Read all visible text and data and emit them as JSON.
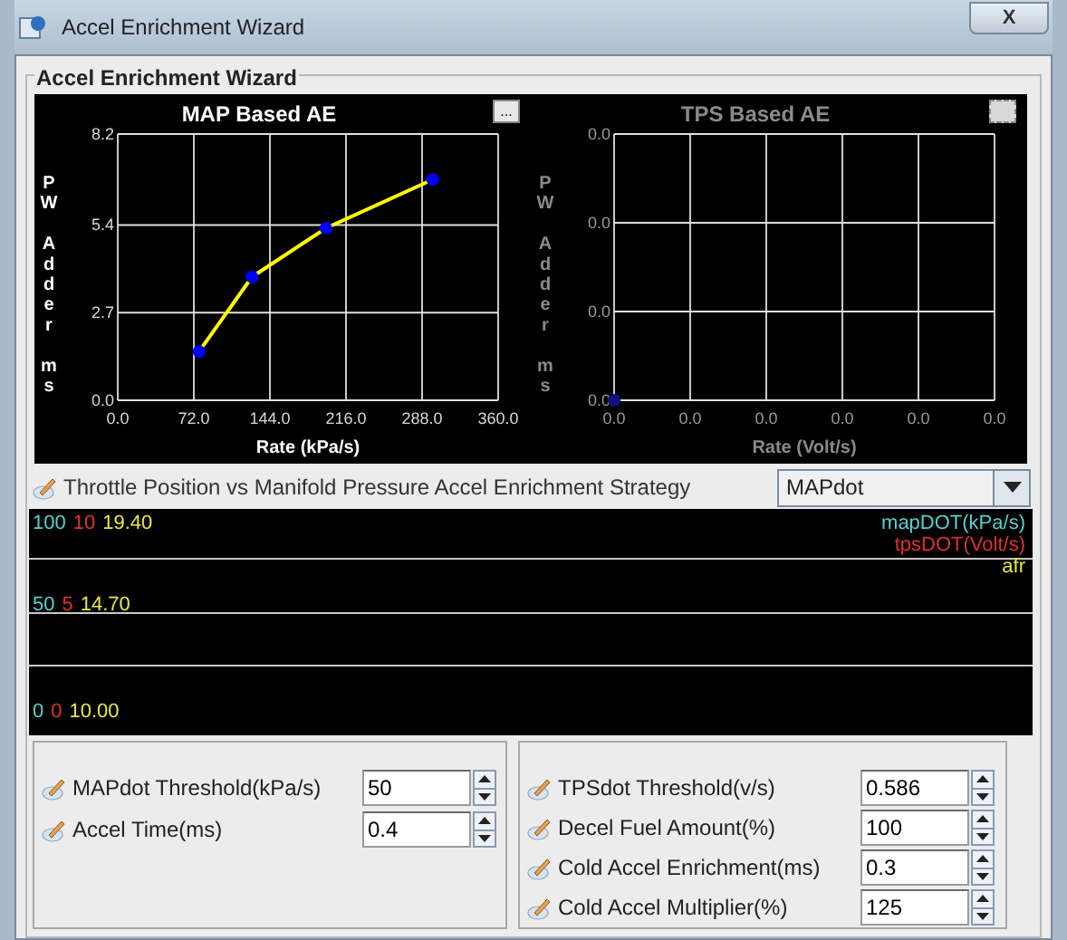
{
  "window": {
    "title": "Accel Enrichment Wizard",
    "close": "X"
  },
  "group_title": "Accel Enrichment Wizard",
  "charts": [
    {
      "disabled": false,
      "menu": "...",
      "chart_data": {
        "type": "line",
        "title": "MAP Based AE",
        "xlabel": "Rate (kPa/s)",
        "ylabel": "PW Adder ms",
        "grid": true,
        "x": [
          77,
          127,
          197,
          298
        ],
        "series": [
          {
            "color": "#ffff00",
            "marker": "circle",
            "values": [
              1.5,
              3.8,
              5.3,
              6.8
            ]
          }
        ],
        "xlim": [
          0,
          360
        ],
        "ylim": [
          0,
          8.2
        ],
        "xticks": [
          {
            "value": 0,
            "label": "0.0"
          },
          {
            "value": 72,
            "label": "72.0"
          },
          {
            "value": 144,
            "label": "144.0"
          },
          {
            "value": 216,
            "label": "216.0"
          },
          {
            "value": 288,
            "label": "288.0"
          },
          {
            "value": 360,
            "label": "360.0"
          }
        ],
        "yticks": [
          {
            "value": 0,
            "label": "0.0"
          },
          {
            "value": 2.7,
            "label": "2.7"
          },
          {
            "value": 5.4,
            "label": "5.4"
          },
          {
            "value": 8.2,
            "label": "8.2"
          }
        ]
      }
    },
    {
      "disabled": true,
      "title": "TPS Based AE",
      "xlabel": "Rate (Volt/s)",
      "ylabel": "PW Adder ms",
      "x_tick_labels": [
        "0.0",
        "0.0",
        "0.0",
        "0.0",
        "0.0",
        "0.0"
      ],
      "y_tick_labels": [
        "0.0",
        "0.0",
        "0.0",
        "0.0"
      ]
    }
  ],
  "strategy": {
    "label": "Throttle Position vs Manifold Pressure Accel Enrichment Strategy",
    "value": "MAPdot"
  },
  "strip_chart": {
    "scales": [
      [
        {
          "text": "100",
          "color": "#55d0d0"
        },
        {
          "text": "10",
          "color": "#e03030"
        },
        {
          "text": "19.40",
          "color": "#e8e840"
        }
      ],
      [
        {
          "text": "50",
          "color": "#55d0d0"
        },
        {
          "text": "5",
          "color": "#e03030"
        },
        {
          "text": "14.70",
          "color": "#e8e840"
        }
      ],
      [
        {
          "text": "0",
          "color": "#55d0d0"
        },
        {
          "text": "0",
          "color": "#e03030"
        },
        {
          "text": "10.00",
          "color": "#e8e840"
        }
      ]
    ],
    "legend": [
      {
        "text": "mapDOT(kPa/s)",
        "color": "#55d0d0"
      },
      {
        "text": "tpsDOT(Volt/s)",
        "color": "#e03030"
      },
      {
        "text": "afr",
        "color": "#e8e840"
      }
    ]
  },
  "left_fields": [
    {
      "label": "MAPdot Threshold(kPa/s)",
      "value": "50"
    },
    {
      "label": "Accel Time(ms)",
      "value": "0.4"
    }
  ],
  "right_fields": [
    {
      "label": "TPSdot Threshold(v/s)",
      "value": "0.586"
    },
    {
      "label": "Decel Fuel Amount(%)",
      "value": "100"
    },
    {
      "label": "Cold Accel Enrichment(ms)",
      "value": "0.3"
    },
    {
      "label": "Cold Accel Multiplier(%)",
      "value": "125"
    }
  ]
}
